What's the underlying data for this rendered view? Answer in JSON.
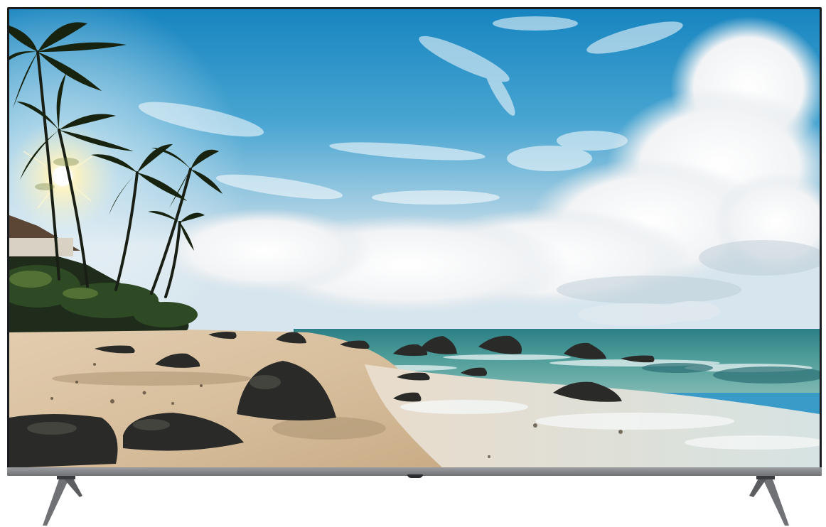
{
  "product": {
    "brand_text": "",
    "colors": {
      "bezel": "#1a1c20",
      "frame_bottom": "#8a8c90",
      "stand": "#6f7175",
      "background": "#ffffff"
    }
  },
  "screen_image": {
    "icon": "beach-landscape-icon",
    "colors": {
      "sky_top": "#1f8fc4",
      "sky_horizon": "#cfe3ee",
      "cloud": "#f4f6f8",
      "sea": "#3f8f8e",
      "foam": "#e8f1f0",
      "sand": "#d9c2a2",
      "rock": "#2a2a28",
      "palm": "#1b2a18",
      "sun": "#fff6cc"
    }
  }
}
